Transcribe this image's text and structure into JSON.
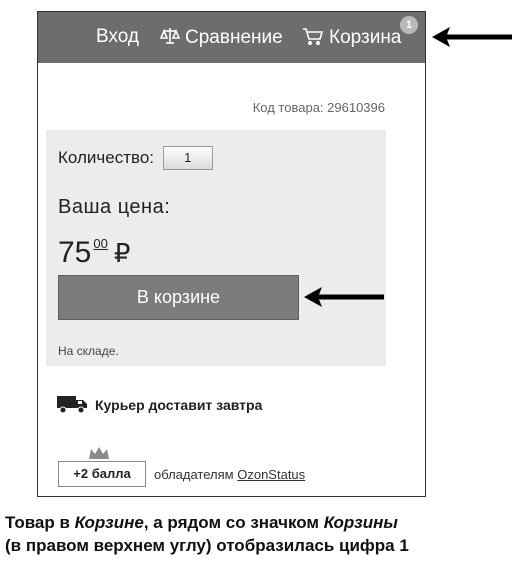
{
  "header": {
    "login_label": "Вход",
    "compare_label": "Сравнение",
    "cart_label": "Корзина",
    "cart_count": "1",
    "icons": {
      "compare": "scales-icon",
      "cart": "cart-icon"
    }
  },
  "product": {
    "sku_text": "Код товара: 29610396",
    "quantity_label": "Количество:",
    "quantity_value": "1",
    "price_label": "Ваша цена:",
    "price_main": "75",
    "price_cents": "00",
    "price_currency": "₽",
    "button_label": "В корзине",
    "stock_text": "На складе."
  },
  "delivery": {
    "text": "Курьер доставит завтра",
    "icon": "truck-icon"
  },
  "loyalty": {
    "badge": "+2 балла",
    "text": "обладателям",
    "link": "OzonStatus",
    "icon": "crown-icon"
  },
  "caption": {
    "line1_a": "Товар в ",
    "line1_b": "Корзине",
    "line1_c": ", а рядом со значком ",
    "line1_d": "Корзины",
    "line2": "(в правом верхнем углу) отобразилась цифра 1"
  },
  "colors": {
    "header_bg": "#6d6d6d",
    "box_bg": "#ececec",
    "button_bg": "#7c7c7c"
  }
}
